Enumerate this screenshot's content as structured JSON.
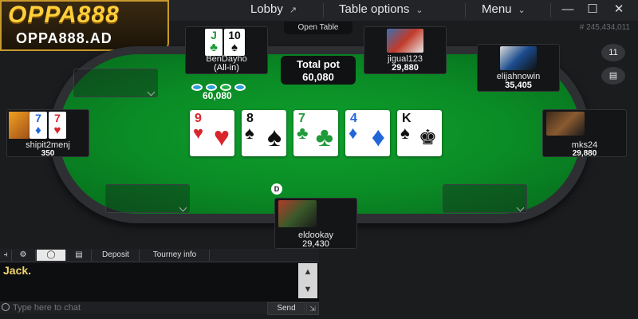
{
  "brand": {
    "logo_text": "OPPA888",
    "domain": "OPPA888.AD",
    "accent": "#ffcf3a"
  },
  "topbar": {
    "lobby": "Lobby",
    "table_options": "Table options",
    "menu": "Menu",
    "minimize": "—",
    "maximize": "☐",
    "close": "✕"
  },
  "open_table": "Open Table",
  "hand_id": "# 245,434,011",
  "pot": {
    "label": "Total pot",
    "value": "60,080",
    "chips_amount": "60,080"
  },
  "players": {
    "top_left": {
      "name": "BenDayho",
      "status": "(All-in)",
      "cards": [
        {
          "rank": "J",
          "suit": "♣"
        },
        {
          "rank": "10",
          "suit": "♠"
        }
      ]
    },
    "top_right": {
      "name": "jigual123",
      "stack": "29,880"
    },
    "right_top": {
      "name": "elijahnowin",
      "stack": "35,405"
    },
    "left": {
      "name": "shipit2menj",
      "stack": "350",
      "cards": [
        {
          "rank": "7",
          "suit": "♦"
        },
        {
          "rank": "7",
          "suit": "♥"
        }
      ]
    },
    "right": {
      "name": "mks24",
      "stack": "29,880"
    },
    "bottom": {
      "name": "eldookay",
      "stack": "29,430"
    }
  },
  "board": [
    {
      "rank": "9",
      "suit": "♥",
      "color": "red"
    },
    {
      "rank": "8",
      "suit": "♠",
      "color": "black"
    },
    {
      "rank": "7",
      "suit": "♣",
      "color": "green"
    },
    {
      "rank": "4",
      "suit": "♦",
      "color": "blue"
    },
    {
      "rank": "K",
      "suit": "♠",
      "color": "black"
    }
  ],
  "dealer_button": "D",
  "side_icons": {
    "top": "11",
    "bottom": "▤"
  },
  "chat": {
    "tabs": [
      "⚙",
      "◯",
      "▤",
      "Deposit",
      "Tourney info"
    ],
    "message": "Jack.",
    "placeholder": "Type here to chat",
    "send": "Send",
    "scroll_up": "▲",
    "scroll_down": "▼"
  }
}
